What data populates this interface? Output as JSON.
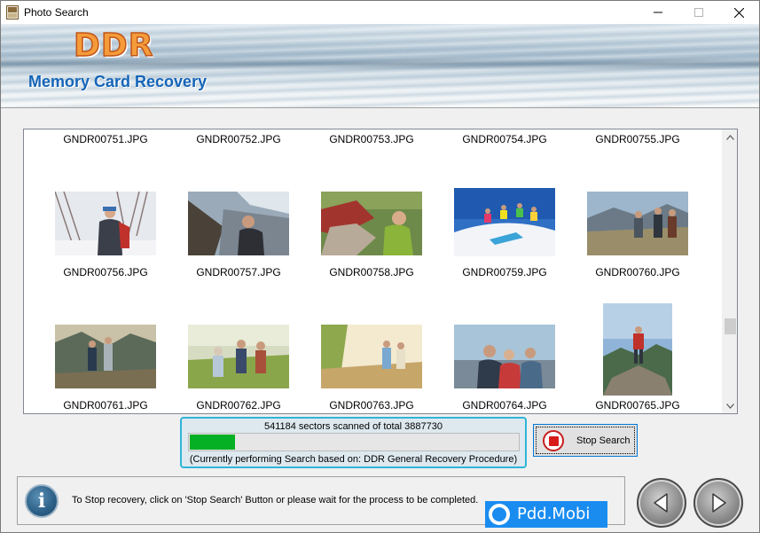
{
  "window": {
    "title": "Photo Search"
  },
  "banner": {
    "brand": "DDR",
    "subtitle": "Memory Card Recovery"
  },
  "photos": {
    "row1": [
      "GNDR00751.JPG",
      "GNDR00752.JPG",
      "GNDR00753.JPG",
      "GNDR00754.JPG",
      "GNDR00755.JPG"
    ],
    "row2": [
      "GNDR00756.JPG",
      "GNDR00757.JPG",
      "GNDR00758.JPG",
      "GNDR00759.JPG",
      "GNDR00760.JPG"
    ],
    "row3": [
      "GNDR00761.JPG",
      "GNDR00762.JPG",
      "GNDR00763.JPG",
      "GNDR00764.JPG",
      "GNDR00765.JPG"
    ]
  },
  "progress": {
    "status": "541184 sectors scanned of total 3887730",
    "sectors_scanned": 541184,
    "sectors_total": 3887730,
    "fraction": 0.139,
    "note": "(Currently performing Search based on:  DDR General Recovery Procedure)",
    "fill_color": "#06b025"
  },
  "stop_button": {
    "label": "Stop Search",
    "icon": "stop-icon"
  },
  "info": {
    "icon": "info-icon",
    "message": "To Stop recovery, click on 'Stop Search' Button or please wait for the process to be completed."
  },
  "watermark": {
    "text": "Pdd.Mobi"
  },
  "navigation": {
    "back_icon": "arrow-left-icon",
    "next_icon": "arrow-right-icon"
  }
}
